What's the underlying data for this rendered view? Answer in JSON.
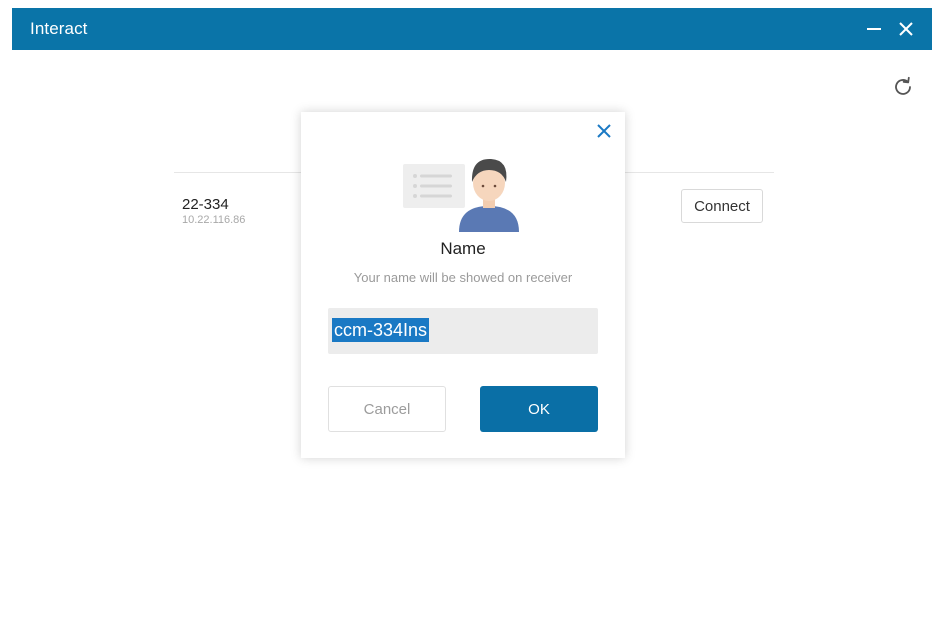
{
  "window": {
    "title": "Interact",
    "accent_color": "#0a74a8",
    "minimize_icon": "minus-icon",
    "close_icon": "close-icon"
  },
  "toolbar": {
    "refresh_icon": "refresh-icon"
  },
  "devices": [
    {
      "name": "22-334",
      "ip": "10.22.116.86",
      "action_label": "Connect"
    }
  ],
  "dialog": {
    "close_icon": "close-icon",
    "illustration_icon": "user-avatar-icon",
    "title": "Name",
    "subtitle": "Your name will be showed on receiver",
    "input_value": "ccm-334Ins",
    "cancel_label": "Cancel",
    "ok_label": "OK",
    "ok_color": "#0a6fa6"
  }
}
